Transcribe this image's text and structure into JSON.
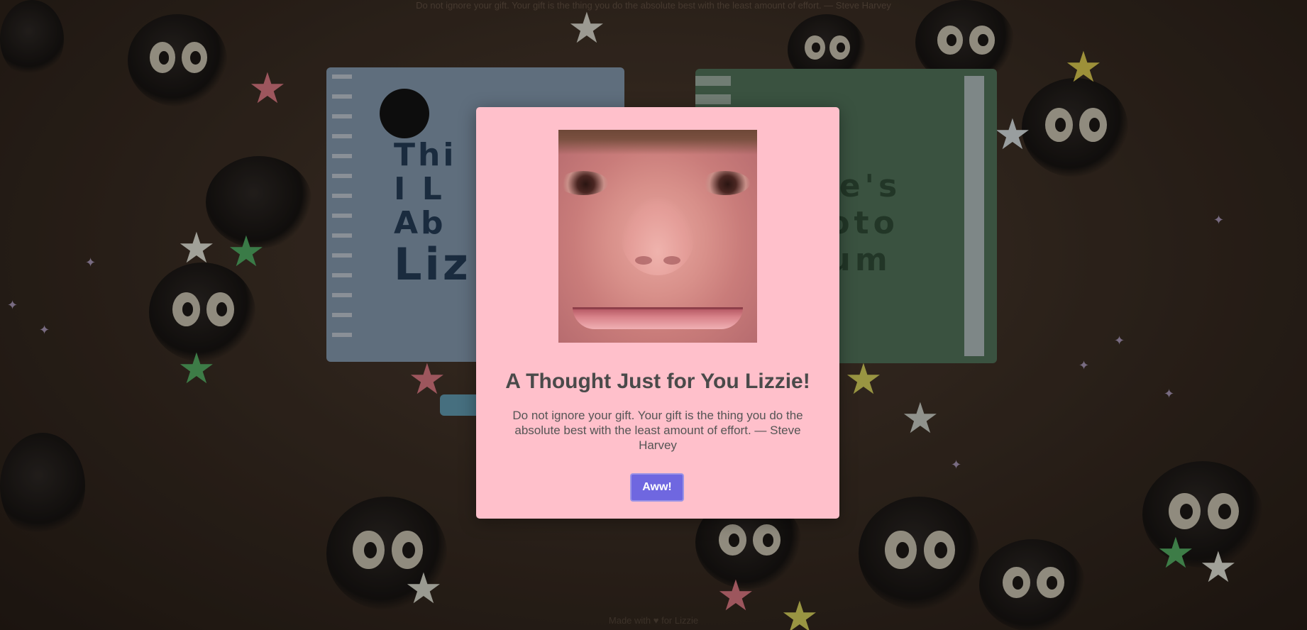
{
  "background": {
    "top_quote": "Do not ignore your gift. Your gift is the thing you do the absolute best with the least amount of effort. — Steve Harvey",
    "bottom_credit": "Made with ♥ for Lizzie",
    "books": {
      "left_title_line1": "Thi",
      "left_title_line2": "I L",
      "left_title_line3": "Ab",
      "left_title_line4": "Liz",
      "right_title_line1": "zie's",
      "right_title_line2": "hoto",
      "right_title_line3": "bum"
    },
    "colors": {
      "background": "#34281f",
      "modal": "#ffc0cb",
      "button": "#6f67e0"
    }
  },
  "modal": {
    "title": "A Thought Just for You Lizzie!",
    "quote": "Do not ignore your gift. Your gift is the thing you do the absolute best with the least amount of effort. — Steve Harvey",
    "button_label": "Aww!"
  }
}
